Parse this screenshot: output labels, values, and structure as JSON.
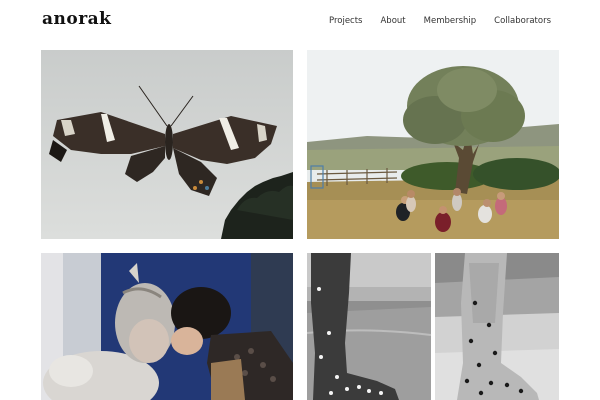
{
  "site": {
    "logo": "anorak"
  },
  "nav": {
    "items": [
      {
        "label": "Projects"
      },
      {
        "label": "About"
      },
      {
        "label": "Membership"
      },
      {
        "label": "Collaborators"
      }
    ]
  },
  "gallery": {
    "tiles": [
      {
        "subject": "butterfly-photo"
      },
      {
        "subject": "olive-tree-meadow-photo"
      },
      {
        "subject": "costumed-figures-photo"
      },
      {
        "subject": "dotted-legs-photo"
      }
    ]
  }
}
